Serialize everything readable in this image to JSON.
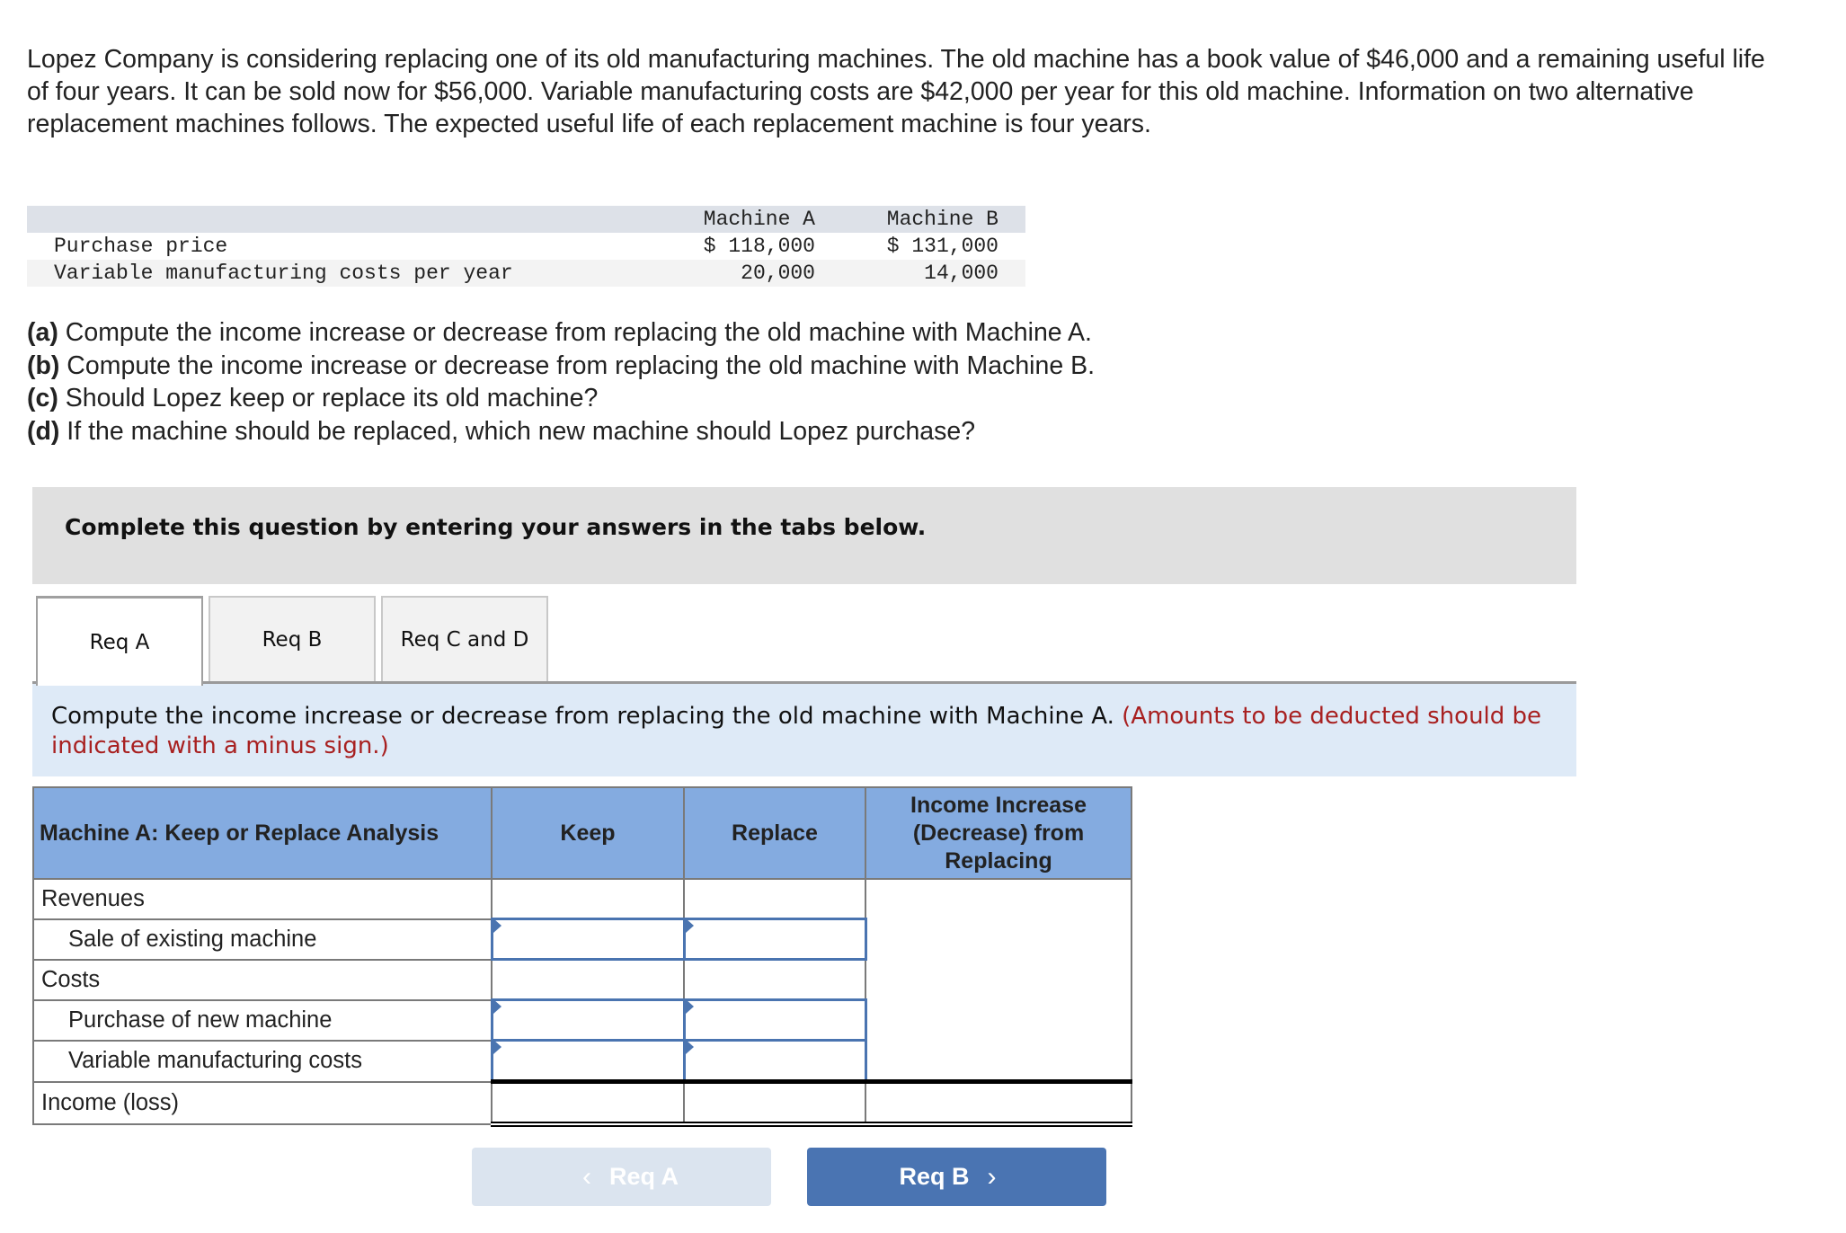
{
  "problem": {
    "intro": "Lopez Company is considering replacing one of its old manufacturing machines. The old machine has a book value of $46,000 and a remaining useful life of four years. It can be sold now for $56,000. Variable manufacturing costs are $42,000 per year for this old machine. Information on two alternative replacement machines follows. The expected useful life of each replacement machine is four years.",
    "given_table": {
      "columns": [
        "",
        "Machine A",
        "Machine B"
      ],
      "rows": [
        {
          "label": "Purchase price",
          "a": "$ 118,000",
          "b": "$ 131,000"
        },
        {
          "label": "Variable manufacturing costs per year",
          "a": "20,000",
          "b": "14,000"
        }
      ]
    },
    "questions": [
      {
        "tag": "(a)",
        "text": " Compute the income increase or decrease from replacing the old machine with Machine A."
      },
      {
        "tag": "(b)",
        "text": " Compute the income increase or decrease from replacing the old machine with Machine B."
      },
      {
        "tag": "(c)",
        "text": " Should Lopez keep or replace its old machine?"
      },
      {
        "tag": "(d)",
        "text": " If the machine should be replaced, which new machine should Lopez purchase?"
      }
    ]
  },
  "instructions_banner": "Complete this question by entering your answers in the tabs below.",
  "tabs": [
    {
      "label": "Req A",
      "active": true
    },
    {
      "label": "Req B",
      "active": false
    },
    {
      "label": "Req C and D",
      "active": false
    }
  ],
  "req_a": {
    "prompt": "Compute the income increase or decrease from replacing the old machine with Machine A.",
    "note": "(Amounts to be deducted should be indicated with a minus sign.)",
    "table": {
      "headers": [
        "Machine A: Keep or Replace Analysis",
        "Keep",
        "Replace",
        "Income Increase (Decrease) from Replacing"
      ],
      "rows": [
        {
          "label": "Revenues",
          "indent": false,
          "keep": "",
          "replace": "",
          "editable": false
        },
        {
          "label": "Sale of existing machine",
          "indent": true,
          "keep": "",
          "replace": "",
          "editable": true
        },
        {
          "label": "Costs",
          "indent": false,
          "keep": "",
          "replace": "",
          "editable": false
        },
        {
          "label": "Purchase of new machine",
          "indent": true,
          "keep": "",
          "replace": "",
          "editable": true
        },
        {
          "label": "Variable manufacturing costs",
          "indent": true,
          "keep": "",
          "replace": "",
          "editable": true
        },
        {
          "label": "Income (loss)",
          "indent": false,
          "keep": "",
          "replace": "",
          "increase": "",
          "editable": false
        }
      ]
    }
  },
  "nav": {
    "prev_label": "Req A",
    "next_label": "Req B",
    "prev_icon": "chevron-left-icon",
    "next_icon": "chevron-right-icon"
  },
  "colors": {
    "header_blue": "#84abe0",
    "input_border": "#4a74b0",
    "note_red": "#a82020",
    "next_button": "#4a74b2",
    "prev_button_disabled": "#dbe4ef"
  }
}
